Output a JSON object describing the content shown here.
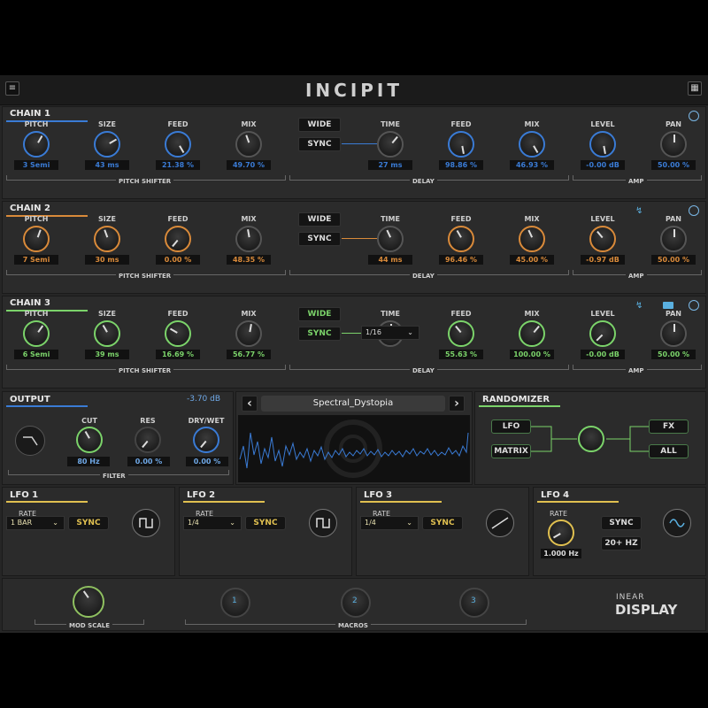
{
  "header": {
    "brand": "INCIPIT",
    "menu_icon": "hamburger-icon",
    "grid_icon": "grid-icon"
  },
  "chains": [
    {
      "title": "CHAIN 1",
      "accent": "#3a7bd5",
      "params": [
        {
          "label": "PITCH",
          "value": "3 Semi"
        },
        {
          "label": "SIZE",
          "value": "43 ms"
        },
        {
          "label": "FEED",
          "value": "21.38 %"
        },
        {
          "label": "MIX",
          "value": "49.70 %"
        },
        {
          "label": "TIME",
          "value": "27 ms"
        },
        {
          "label": "FEED",
          "value": "98.86 %"
        },
        {
          "label": "MIX",
          "value": "46.93 %"
        },
        {
          "label": "LEVEL",
          "value": "-0.00 dB"
        },
        {
          "label": "PAN",
          "value": "50.00 %"
        }
      ]
    },
    {
      "title": "CHAIN 2",
      "accent": "#d98a3a",
      "params": [
        {
          "label": "PITCH",
          "value": "7 Semi"
        },
        {
          "label": "SIZE",
          "value": "30 ms"
        },
        {
          "label": "FEED",
          "value": "0.00 %"
        },
        {
          "label": "MIX",
          "value": "48.35 %"
        },
        {
          "label": "TIME",
          "value": "44 ms"
        },
        {
          "label": "FEED",
          "value": "96.46 %"
        },
        {
          "label": "MIX",
          "value": "45.00 %"
        },
        {
          "label": "LEVEL",
          "value": "-0.97 dB"
        },
        {
          "label": "PAN",
          "value": "50.00 %"
        }
      ]
    },
    {
      "title": "CHAIN 3",
      "accent": "#7bd36a",
      "params": [
        {
          "label": "PITCH",
          "value": "6 Semi"
        },
        {
          "label": "SIZE",
          "value": "39 ms"
        },
        {
          "label": "FEED",
          "value": "16.69 %"
        },
        {
          "label": "MIX",
          "value": "56.77 %"
        },
        {
          "label": "TIME",
          "value": ""
        },
        {
          "label": "FEED",
          "value": "55.63 %"
        },
        {
          "label": "MIX",
          "value": "100.00 %"
        },
        {
          "label": "LEVEL",
          "value": "-0.00 dB"
        },
        {
          "label": "PAN",
          "value": "50.00 %"
        }
      ],
      "sync_division": "1/16"
    }
  ],
  "sections": {
    "pitch_shifter": "PITCH SHIFTER",
    "delay": "DELAY",
    "amp": "AMP",
    "wide": "WIDE",
    "sync": "SYNC"
  },
  "output": {
    "title": "OUTPUT",
    "level": "-3.70 dB",
    "cut_label": "CUT",
    "cut": "80 Hz",
    "res_label": "RES",
    "res": "0.00 %",
    "drywet_label": "DRY/WET",
    "drywet": "0.00 %",
    "filter": "FILTER"
  },
  "preset": {
    "name": "Spectral_Dystopia",
    "prev": "‹",
    "next": "›"
  },
  "randomizer": {
    "title": "RANDOMIZER",
    "lfo": "LFO",
    "matrix": "MATRIX",
    "fx": "FX",
    "all": "ALL"
  },
  "lfos": [
    {
      "title": "LFO 1",
      "rate_label": "RATE",
      "rate": "1 BAR",
      "sync": "SYNC",
      "shape": "square"
    },
    {
      "title": "LFO 2",
      "rate_label": "RATE",
      "rate": "1/4",
      "sync": "SYNC",
      "shape": "square"
    },
    {
      "title": "LFO 3",
      "rate_label": "RATE",
      "rate": "1/4",
      "sync": "SYNC",
      "shape": "ramp"
    },
    {
      "title": "LFO 4",
      "rate_label": "RATE",
      "rate": "1.000 Hz",
      "sync": "SYNC",
      "sync2": "20+ HZ",
      "shape": "sine"
    }
  ],
  "bottom": {
    "mod_scale": "MOD SCALE",
    "macros": "MACROS",
    "m1": "1",
    "m2": "2",
    "m3": "3",
    "logo_top": "INEAR",
    "logo_bottom": "DISPLAY"
  },
  "colors": {
    "blue": "#3a7bd5",
    "orange": "#d98a3a",
    "green": "#7bd36a",
    "yellow": "#e0c050",
    "lfo_line": "#e0c050"
  }
}
